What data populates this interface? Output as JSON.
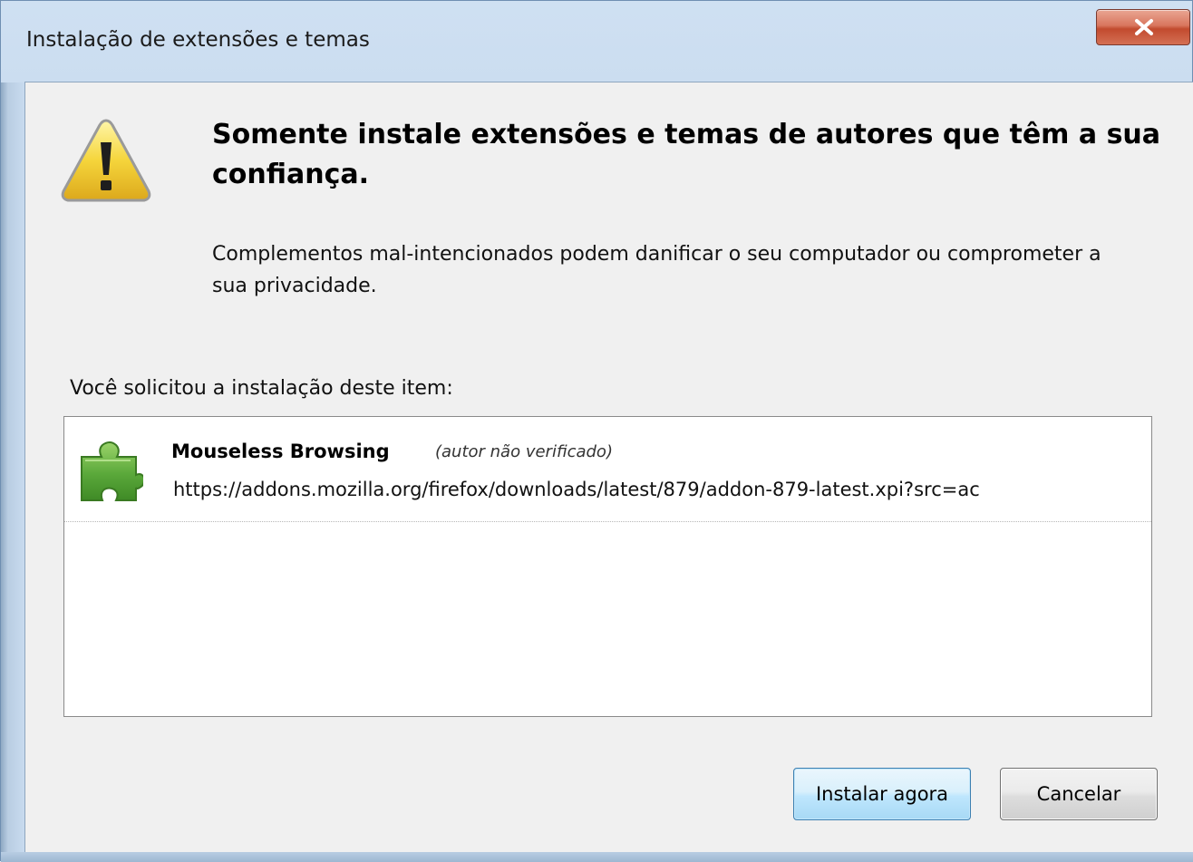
{
  "window": {
    "title": "Instalação de extensões e temas"
  },
  "dialog": {
    "heading": "Somente instale extensões e temas de autores que têm a sua confiança.",
    "description": "Complementos mal-intencionados podem danificar o seu computador ou comprometer a sua privacidade.",
    "request_label": "Você solicitou a instalação deste item:"
  },
  "addons": [
    {
      "name": "Mouseless Browsing",
      "note": "(autor não verificado)",
      "url": "https://addons.mozilla.org/firefox/downloads/latest/879/addon-879-latest.xpi?src=ac",
      "icon": "puzzle-piece-icon"
    }
  ],
  "buttons": {
    "install": "Instalar agora",
    "cancel": "Cancelar"
  },
  "icons": {
    "warning": "warning-icon",
    "close": "close-icon"
  },
  "colors": {
    "close_button": "#d9765e",
    "default_button_border": "#3c7fb1",
    "puzzle_green": "#5aa83a",
    "warning_yellow": "#f5d53b"
  }
}
